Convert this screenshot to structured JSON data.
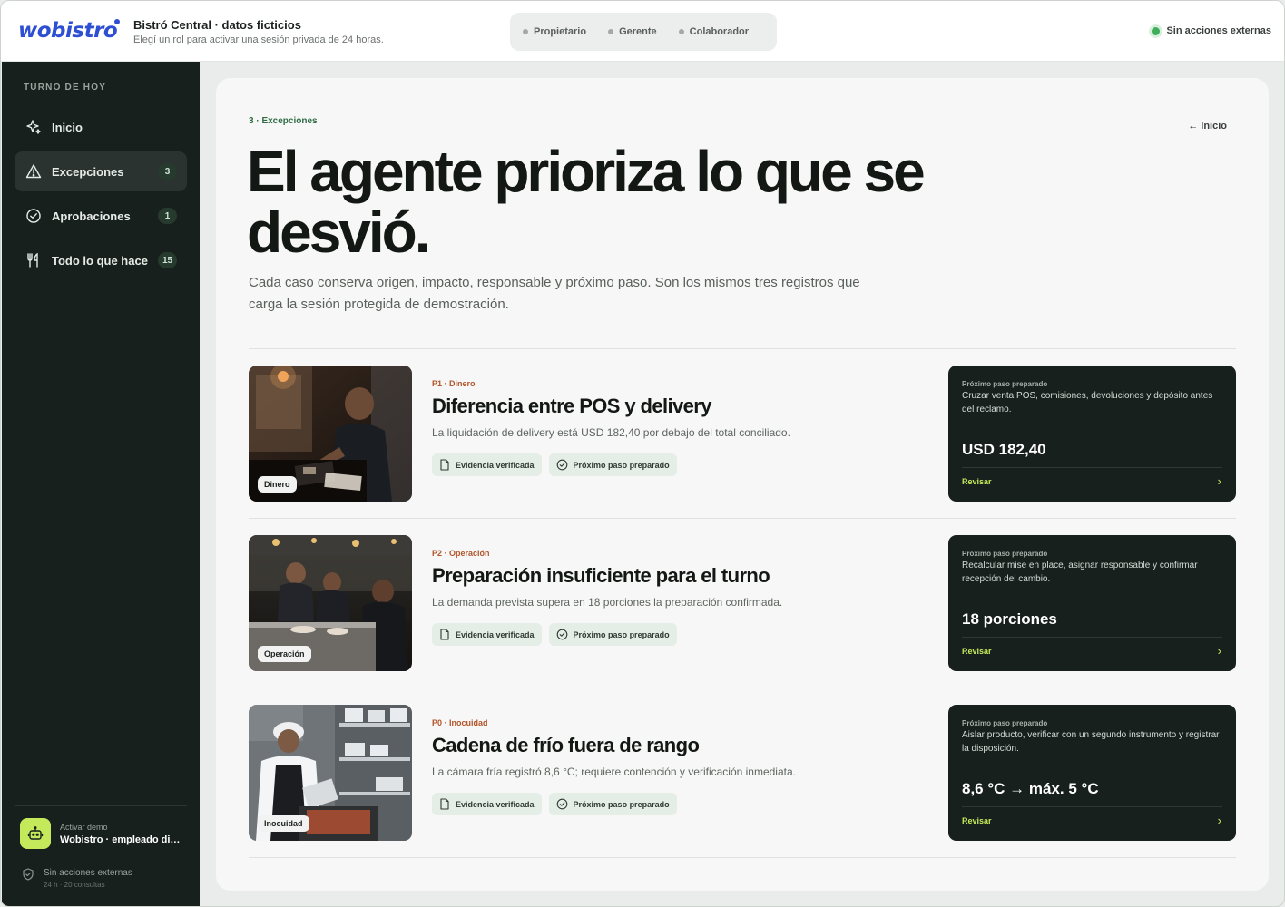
{
  "brand": {
    "logo_text": "wobistro",
    "accent": "#2f4fd3"
  },
  "header": {
    "org_title": "Bistró Central · datos ficticios",
    "org_subtitle": "Elegí un rol para activar una sesión privada de 24 horas.",
    "roles": [
      "Propietario",
      "Gerente",
      "Colaborador"
    ],
    "status": "Sin acciones externas"
  },
  "sidebar": {
    "heading": "TURNO DE HOY",
    "items": [
      {
        "label": "Inicio",
        "icon": "sparkle-icon",
        "badge": ""
      },
      {
        "label": "Excepciones",
        "icon": "warning-icon",
        "badge": "3"
      },
      {
        "label": "Aprobaciones",
        "icon": "check-circle-icon",
        "badge": "1"
      },
      {
        "label": "Todo lo que hace",
        "icon": "fork-knife-icon",
        "badge": "15"
      }
    ],
    "demo_label": "Activar demo",
    "demo_name": "Wobistro · empleado digital",
    "footer_title": "Sin acciones externas",
    "footer_sub": "24 h · 20 consultas"
  },
  "main": {
    "eyebrow": "3 · Excepciones",
    "back_label": "← Inicio",
    "headline": "El agente prioriza lo que se desvió.",
    "lead": "Cada caso conserva origen, impacto, responsable y próximo paso. Son los mismos tres registros que carga la sesión protegida de demostración.",
    "chip_evidence": "Evidencia verificada",
    "chip_next": "Próximo paso preparado",
    "action_label": "Próximo paso preparado",
    "review_label": "Revisar",
    "cases": [
      {
        "tag": "Dinero",
        "priority": "P1 · Dinero",
        "title": "Diferencia entre POS y delivery",
        "desc": "La liquidación de delivery está USD 182,40 por debajo del total conciliado.",
        "action_desc": "Cruzar venta POS, comisiones, devoluciones y depósito antes del reclamo.",
        "value": "USD 182,40"
      },
      {
        "tag": "Operación",
        "priority": "P2 · Operación",
        "title": "Preparación insuficiente para el turno",
        "desc": "La demanda prevista supera en 18 porciones la preparación confirmada.",
        "action_desc": "Recalcular mise en place, asignar responsable y confirmar recepción del cambio.",
        "value": "18 porciones"
      },
      {
        "tag": "Inocuidad",
        "priority": "P0 · Inocuidad",
        "title": "Cadena de frío fuera de rango",
        "desc": "La cámara fría registró 8,6 °C; requiere contención y verificación inmediata.",
        "action_desc": "Aislar producto, verificar con un segundo instrumento y registrar la disposición.",
        "value": "8,6 °C → máx. 5 °C"
      }
    ]
  }
}
